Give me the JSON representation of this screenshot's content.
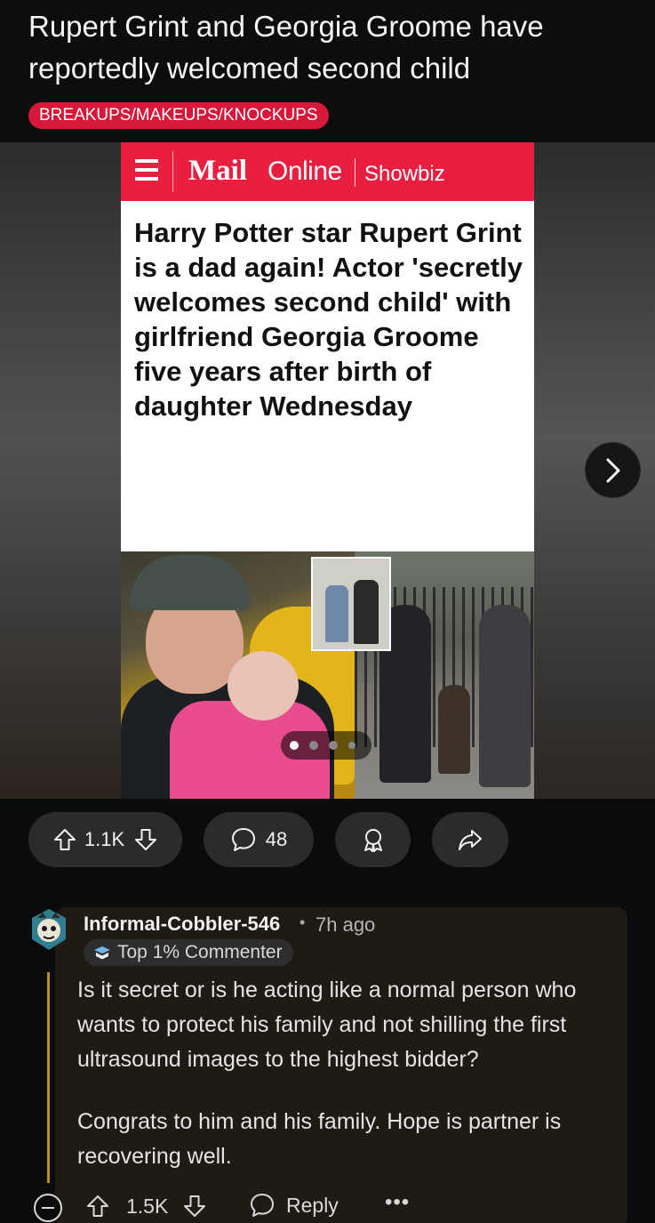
{
  "post": {
    "title": "Rupert Grint and Georgia Groome have reportedly welcomed second child",
    "flair": "BREAKUPS/MAKEUPS/KNOCKUPS"
  },
  "article": {
    "brand_mail": "Mail",
    "brand_online": "Online",
    "section": "Showbiz",
    "headline": "Harry Potter star Rupert Grint is a dad again! Actor 'secretly welcomes second child' with girlfriend Georgia Groome five years after birth of daughter Wednesday"
  },
  "gallery": {
    "current_index": 1,
    "total": 4,
    "next_icon": "chevron-right-icon"
  },
  "actions": {
    "upvotes": "1.1K",
    "comments": "48",
    "award_icon": "award-icon",
    "share_icon": "share-icon"
  },
  "comment": {
    "username": "Informal-Cobbler-546",
    "separator": "•",
    "time": "7h ago",
    "badge": "Top 1% Commenter",
    "paragraphs": [
      "Is it secret or is he acting like a normal person who wants to protect his family and not shilling the first ultrasound images to the highest bidder?",
      "Congrats to him and his family. Hope is partner is recovering well."
    ],
    "votes": "1.5K",
    "reply_label": "Reply",
    "more_label": "•••"
  },
  "colors": {
    "flair": "#d6193a",
    "mail_red": "#e91f3f",
    "thread_line": "#b88f28",
    "pill_bg": "#2a2b2d"
  }
}
